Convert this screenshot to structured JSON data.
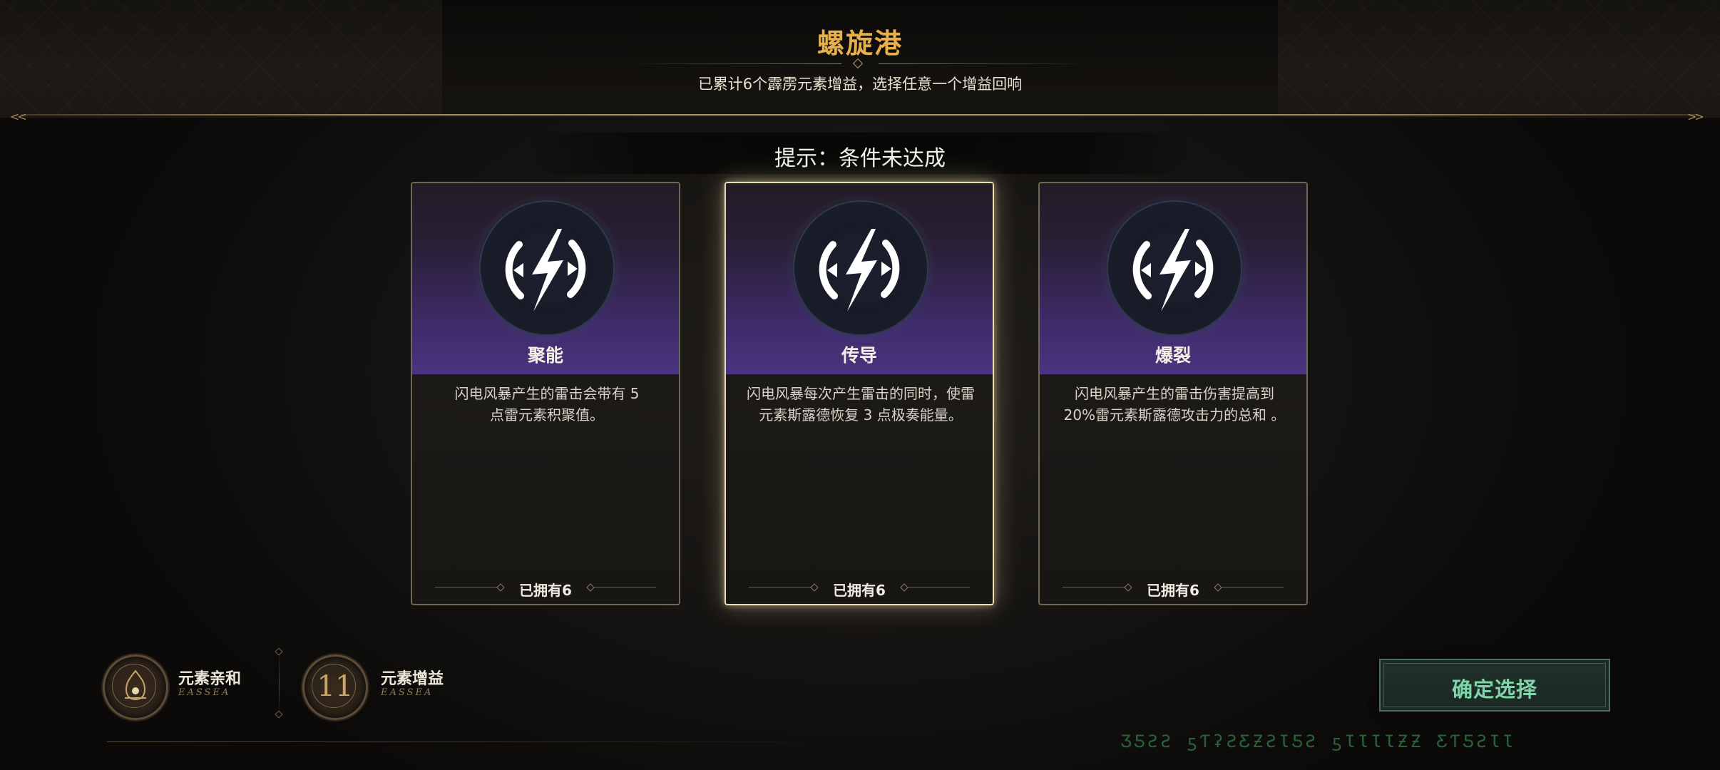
{
  "header": {
    "title": "螺旋港",
    "subtitle": "已累计6个霹雳元素增益，选择任意一个增益回响"
  },
  "hint": {
    "text": "提示：条件未达成"
  },
  "cards": [
    {
      "name": "聚能",
      "description_lines": [
        "闪电风暴产生的雷击会带有 5",
        "点雷元素积聚值。"
      ],
      "owned": "已拥有6",
      "icon": "lightning-emblem-icon",
      "selected": false
    },
    {
      "name": "传导",
      "description_lines": [
        "闪电风暴每次产生雷击的同时，使雷",
        "元素斯露德恢复 3 点极奏能量。"
      ],
      "owned": "已拥有6",
      "icon": "lightning-emblem-icon",
      "selected": true
    },
    {
      "name": "爆裂",
      "description_lines": [
        "闪电风暴产生的雷击伤害提高到",
        "20%雷元素斯露德攻击力的总和 。"
      ],
      "owned": "已拥有6",
      "icon": "lightning-emblem-icon",
      "selected": false
    }
  ],
  "stats": {
    "affinity": {
      "label": "元素亲和",
      "sub": "EASSEA",
      "icon": "element-affinity-medal-icon"
    },
    "buff": {
      "label": "元素增益",
      "sub": "EASSEA",
      "value": "11",
      "icon": "element-buff-medal-icon"
    }
  },
  "confirm": {
    "label": "确定选择"
  },
  "decor": {
    "runes": "ƷƼƧƧ ƽƬʡƧƸƵƧƖƼƧ ƽƖƖƖƖƵƵ ƸƬƼƧƖƖ"
  },
  "colors": {
    "title_gold": "#e8b04a",
    "card_purple": "#4a3480",
    "selected_border": "#e9dcb4",
    "confirm_green": "#7fd4aa"
  }
}
